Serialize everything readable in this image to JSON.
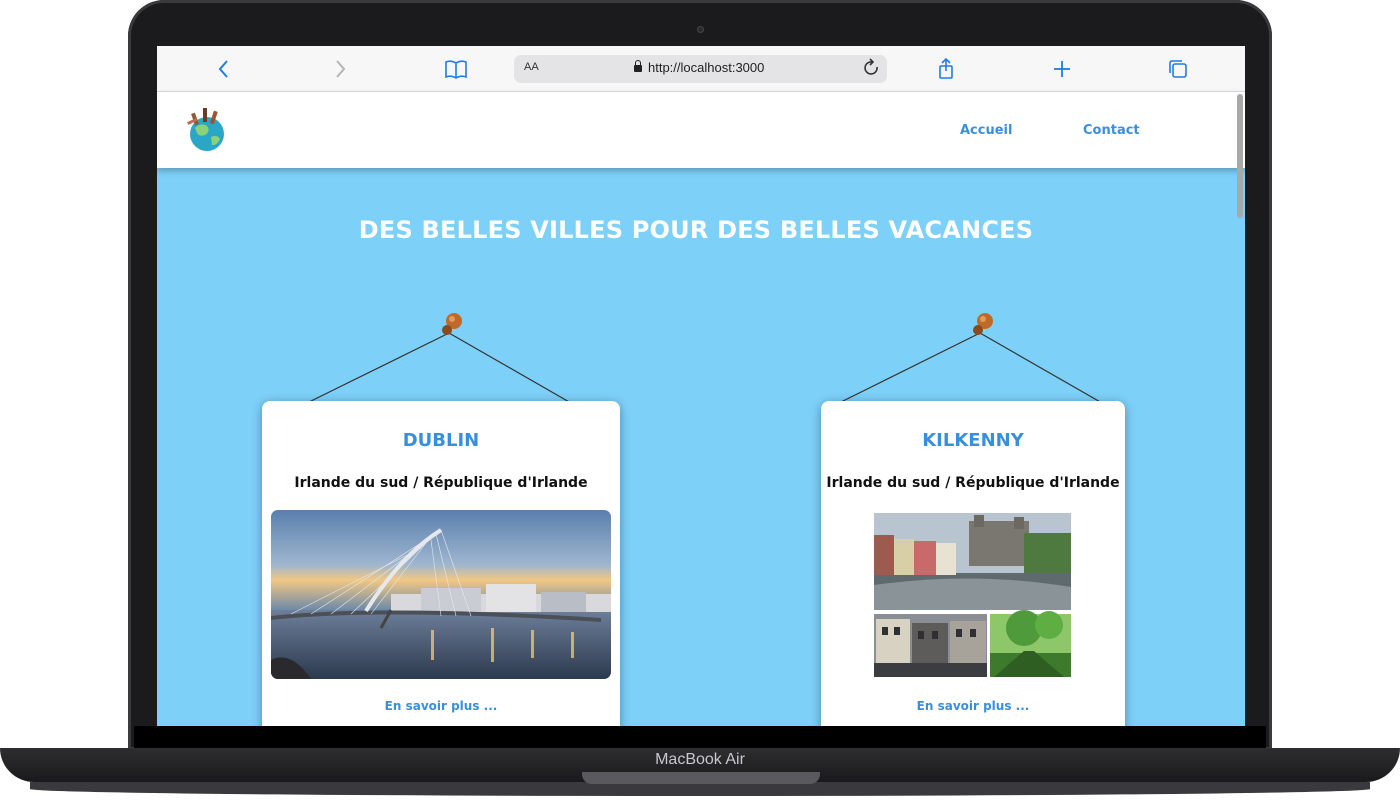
{
  "device": {
    "label": "MacBook Air"
  },
  "browser": {
    "text_size_label": "AA",
    "url": "http://localhost:3000",
    "icons": [
      "back-icon",
      "forward-icon",
      "bookmarks-icon",
      "lock-icon",
      "reload-icon",
      "share-icon",
      "new-tab-icon",
      "tabs-icon"
    ]
  },
  "site": {
    "nav": {
      "home": "Accueil",
      "contact": "Contact"
    },
    "hero_title": "DES BELLES VILLES POUR DES BELLES VACANCES",
    "cards": [
      {
        "city": "DUBLIN",
        "region": "Irlande du sud / République d'Irlande",
        "link": "En savoir plus ..."
      },
      {
        "city": "KILKENNY",
        "region": "Irlande du sud / République d'Irlande",
        "link": "En savoir plus ..."
      }
    ]
  },
  "colors": {
    "background": "#7dd0f8",
    "accent": "#3a8fdc",
    "toolbar_blue": "#1f7be6"
  }
}
